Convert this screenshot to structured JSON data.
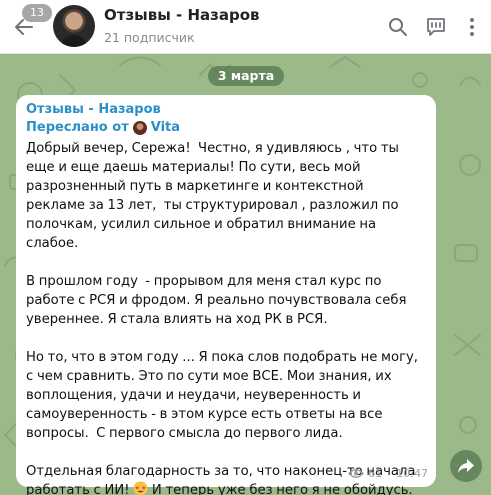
{
  "header": {
    "unread_count": "13",
    "title": "Отзывы - Назаров",
    "subtitle": "21 подписчик"
  },
  "date_label": "3 марта",
  "message": {
    "channel_name": "Отзывы - Назаров",
    "forwarded_prefix": "Переслано от",
    "forwarded_from": "Vita",
    "paragraphs": [
      "Добрый вечер, Сережа!  Честно, я удивляюсь , что ты еще и еще даешь материалы! По сути, весь мой разрозненный путь в маркетинге и контекстной рекламе за 13 лет,  ты структурировал , разложил по полочкам, усилил сильное и обратил внимание на слабое.",
      "В прошлом году  - прорывом для меня стал курс по работе с РСЯ и фродом. Я реально почувствовала себя увереннее. Я стала влиять на ход РК в РСЯ.",
      "Но то, что в этом году ... Я пока слов подобрать не могу, с чем сравнить. Это по сути мое ВСЕ. Мои знания, их воплощения, удачи и неудачи, неуверенность и самоуверенность - в этом курсе есть ответы на все вопросы.  С первого смысла до первого лида."
    ],
    "last_paragraph_a": "Отдельная благодарность за то, что наконец-то начала работать с ИИ! ",
    "last_paragraph_b": " И теперь уже без него я не обойдусь. Спасибо тебе, Сережа ",
    "views": "61",
    "time": "10:47"
  },
  "icons": {
    "back": "back-arrow-icon",
    "search": "search-icon",
    "comments": "chat-bubble-icon",
    "more": "more-vertical-icon",
    "share": "share-forward-icon",
    "views": "eye-icon"
  },
  "colors": {
    "accent": "#2c8fc7",
    "chat_background": "#9cb98a"
  }
}
